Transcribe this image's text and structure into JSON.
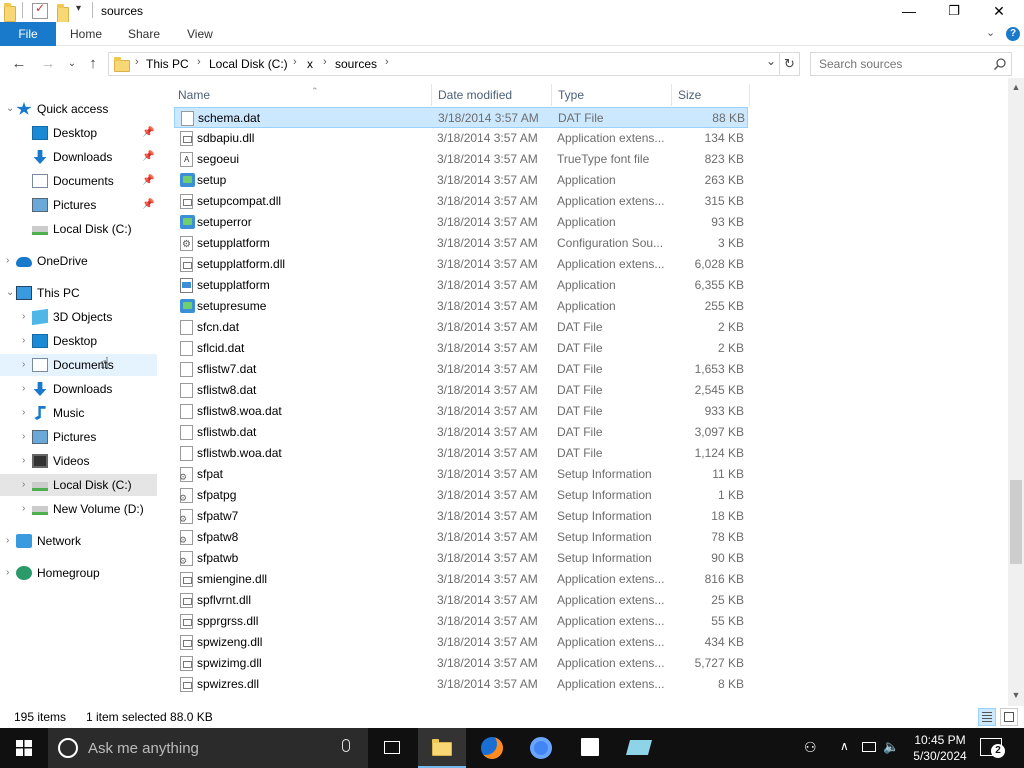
{
  "window": {
    "title": "sources",
    "minimize": "—",
    "maximize": "❐",
    "close": "✕"
  },
  "ribbon": {
    "tabs": [
      "File",
      "Home",
      "Share",
      "View"
    ],
    "help": "?"
  },
  "address": {
    "crumbs": [
      "This PC",
      "Local Disk (C:)",
      "x",
      "sources"
    ],
    "separator": "›",
    "search_placeholder": "Search sources"
  },
  "nav": {
    "items": [
      {
        "label": "Quick access",
        "icon": "star-icon"
      },
      {
        "label": "Desktop",
        "icon": "desktop-icon"
      },
      {
        "label": "Downloads",
        "icon": "downloads-icon"
      },
      {
        "label": "Documents",
        "icon": "documents-icon"
      },
      {
        "label": "Pictures",
        "icon": "pictures-icon"
      },
      {
        "label": "Local Disk (C:)",
        "icon": "drive-icon"
      },
      {
        "label": "OneDrive",
        "icon": "cloud-icon"
      },
      {
        "label": "This PC",
        "icon": "computer-icon"
      },
      {
        "label": "3D Objects",
        "icon": "cube-icon"
      },
      {
        "label": "Desktop",
        "icon": "desktop-icon"
      },
      {
        "label": "Documents",
        "icon": "documents-icon"
      },
      {
        "label": "Downloads",
        "icon": "downloads-icon"
      },
      {
        "label": "Music",
        "icon": "music-icon"
      },
      {
        "label": "Pictures",
        "icon": "pictures-icon"
      },
      {
        "label": "Videos",
        "icon": "videos-icon"
      },
      {
        "label": "Local Disk (C:)",
        "icon": "drive-icon"
      },
      {
        "label": "New Volume (D:)",
        "icon": "drive-icon"
      },
      {
        "label": "Network",
        "icon": "network-icon"
      },
      {
        "label": "Homegroup",
        "icon": "homegroup-icon"
      }
    ]
  },
  "columns": {
    "name": "Name",
    "date": "Date modified",
    "type": "Type",
    "size": "Size"
  },
  "files": [
    {
      "name": "schema.dat",
      "date": "3/18/2014 3:57 AM",
      "type": "DAT File",
      "size": "88 KB",
      "icon": "file"
    },
    {
      "name": "sdbapiu.dll",
      "date": "3/18/2014 3:57 AM",
      "type": "Application extens...",
      "size": "134 KB",
      "icon": "dll"
    },
    {
      "name": "segoeui",
      "date": "3/18/2014 3:57 AM",
      "type": "TrueType font file",
      "size": "823 KB",
      "icon": "font"
    },
    {
      "name": "setup",
      "date": "3/18/2014 3:57 AM",
      "type": "Application",
      "size": "263 KB",
      "icon": "app"
    },
    {
      "name": "setupcompat.dll",
      "date": "3/18/2014 3:57 AM",
      "type": "Application extens...",
      "size": "315 KB",
      "icon": "dll"
    },
    {
      "name": "setuperror",
      "date": "3/18/2014 3:57 AM",
      "type": "Application",
      "size": "93 KB",
      "icon": "app"
    },
    {
      "name": "setupplatform",
      "date": "3/18/2014 3:57 AM",
      "type": "Configuration Sou...",
      "size": "3 KB",
      "icon": "cfg"
    },
    {
      "name": "setupplatform.dll",
      "date": "3/18/2014 3:57 AM",
      "type": "Application extens...",
      "size": "6,028 KB",
      "icon": "dll"
    },
    {
      "name": "setupplatform",
      "date": "3/18/2014 3:57 AM",
      "type": "Application",
      "size": "6,355 KB",
      "icon": "win"
    },
    {
      "name": "setupresume",
      "date": "3/18/2014 3:57 AM",
      "type": "Application",
      "size": "255 KB",
      "icon": "app"
    },
    {
      "name": "sfcn.dat",
      "date": "3/18/2014 3:57 AM",
      "type": "DAT File",
      "size": "2 KB",
      "icon": "file"
    },
    {
      "name": "sflcid.dat",
      "date": "3/18/2014 3:57 AM",
      "type": "DAT File",
      "size": "2 KB",
      "icon": "file"
    },
    {
      "name": "sflistw7.dat",
      "date": "3/18/2014 3:57 AM",
      "type": "DAT File",
      "size": "1,653 KB",
      "icon": "file"
    },
    {
      "name": "sflistw8.dat",
      "date": "3/18/2014 3:57 AM",
      "type": "DAT File",
      "size": "2,545 KB",
      "icon": "file"
    },
    {
      "name": "sflistw8.woa.dat",
      "date": "3/18/2014 3:57 AM",
      "type": "DAT File",
      "size": "933 KB",
      "icon": "file"
    },
    {
      "name": "sflistwb.dat",
      "date": "3/18/2014 3:57 AM",
      "type": "DAT File",
      "size": "3,097 KB",
      "icon": "file"
    },
    {
      "name": "sflistwb.woa.dat",
      "date": "3/18/2014 3:57 AM",
      "type": "DAT File",
      "size": "1,124 KB",
      "icon": "file"
    },
    {
      "name": "sfpat",
      "date": "3/18/2014 3:57 AM",
      "type": "Setup Information",
      "size": "11 KB",
      "icon": "inf"
    },
    {
      "name": "sfpatpg",
      "date": "3/18/2014 3:57 AM",
      "type": "Setup Information",
      "size": "1 KB",
      "icon": "inf"
    },
    {
      "name": "sfpatw7",
      "date": "3/18/2014 3:57 AM",
      "type": "Setup Information",
      "size": "18 KB",
      "icon": "inf"
    },
    {
      "name": "sfpatw8",
      "date": "3/18/2014 3:57 AM",
      "type": "Setup Information",
      "size": "78 KB",
      "icon": "inf"
    },
    {
      "name": "sfpatwb",
      "date": "3/18/2014 3:57 AM",
      "type": "Setup Information",
      "size": "90 KB",
      "icon": "inf"
    },
    {
      "name": "smiengine.dll",
      "date": "3/18/2014 3:57 AM",
      "type": "Application extens...",
      "size": "816 KB",
      "icon": "dll"
    },
    {
      "name": "spflvrnt.dll",
      "date": "3/18/2014 3:57 AM",
      "type": "Application extens...",
      "size": "25 KB",
      "icon": "dll"
    },
    {
      "name": "spprgrss.dll",
      "date": "3/18/2014 3:57 AM",
      "type": "Application extens...",
      "size": "55 KB",
      "icon": "dll"
    },
    {
      "name": "spwizeng.dll",
      "date": "3/18/2014 3:57 AM",
      "type": "Application extens...",
      "size": "434 KB",
      "icon": "dll"
    },
    {
      "name": "spwizimg.dll",
      "date": "3/18/2014 3:57 AM",
      "type": "Application extens...",
      "size": "5,727 KB",
      "icon": "dll"
    },
    {
      "name": "spwizres.dll",
      "date": "3/18/2014 3:57 AM",
      "type": "Application extens...",
      "size": "8 KB",
      "icon": "dll"
    }
  ],
  "selected_index": 0,
  "status": {
    "count": "195 items",
    "selection": "1 item selected  88.0 KB"
  },
  "taskbar": {
    "search_placeholder": "Ask me anything",
    "time": "10:45 PM",
    "date": "5/30/2024",
    "notifications": "2"
  },
  "colors": {
    "accent": "#1979ca",
    "selection": "#cce8ff",
    "taskbar": "#101010"
  }
}
